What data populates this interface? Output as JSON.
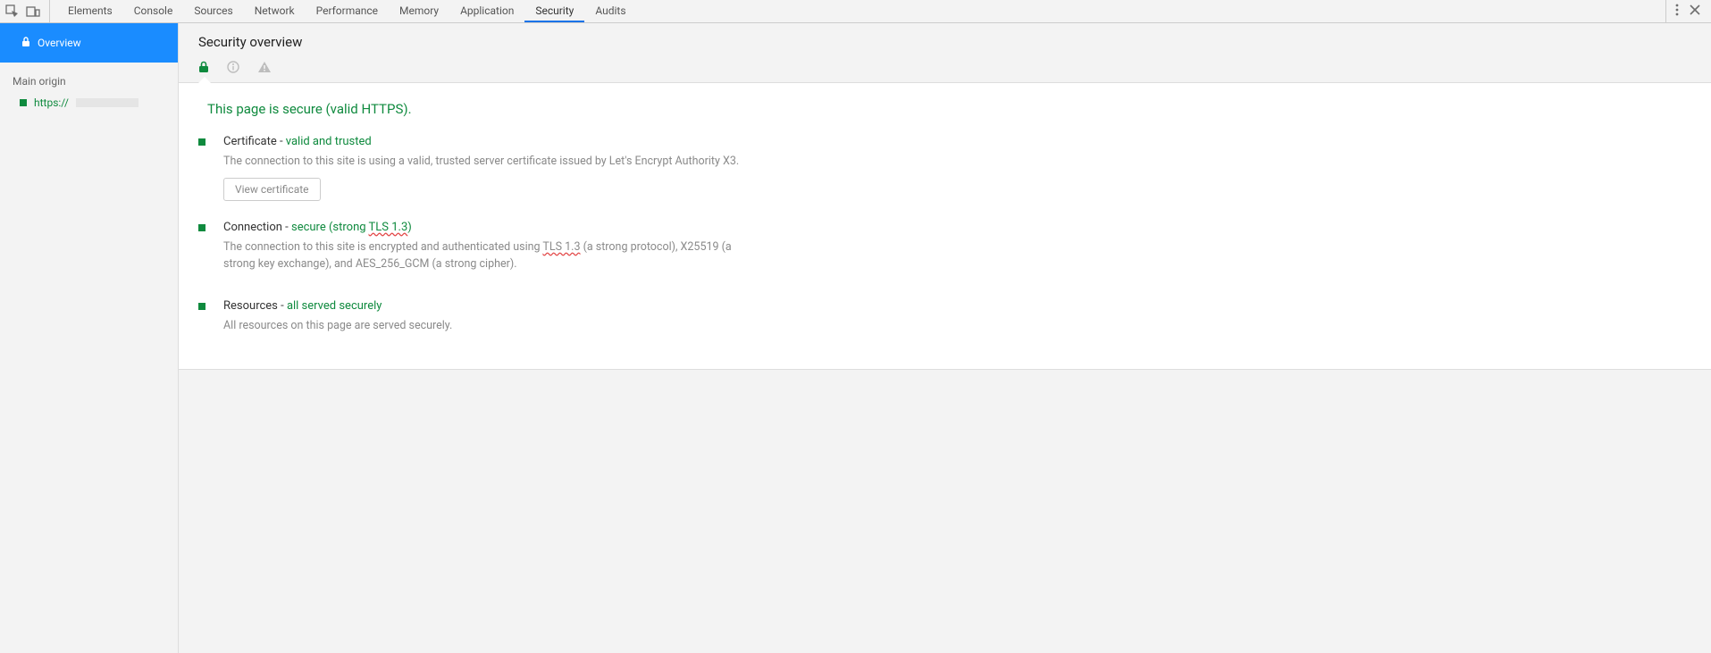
{
  "toolbar": {
    "tabs": [
      "Elements",
      "Console",
      "Sources",
      "Network",
      "Performance",
      "Memory",
      "Application",
      "Security",
      "Audits"
    ],
    "active_tab": "Security"
  },
  "sidebar": {
    "overview_label": "Overview",
    "main_origin_label": "Main origin",
    "origin_prefix": "https://"
  },
  "content": {
    "title": "Security overview",
    "headline": "This page is secure (valid HTTPS).",
    "sections": {
      "certificate": {
        "title_prefix": "Certificate - ",
        "title_status": "valid and trusted",
        "desc": "The connection to this site is using a valid, trusted server certificate issued by Let's Encrypt Authority X3.",
        "button": "View certificate"
      },
      "connection": {
        "title_prefix": "Connection - ",
        "title_status_a": "secure (strong ",
        "title_status_b": "TLS 1.3",
        "title_status_c": ")",
        "desc_a": "The connection to this site is encrypted and authenticated using ",
        "desc_b": "TLS 1.3",
        "desc_c": " (a strong protocol), X25519 (a strong key exchange), and AES_256_GCM (a strong cipher)."
      },
      "resources": {
        "title_prefix": "Resources - ",
        "title_status": "all served securely",
        "desc": "All resources on this page are served securely."
      }
    }
  }
}
